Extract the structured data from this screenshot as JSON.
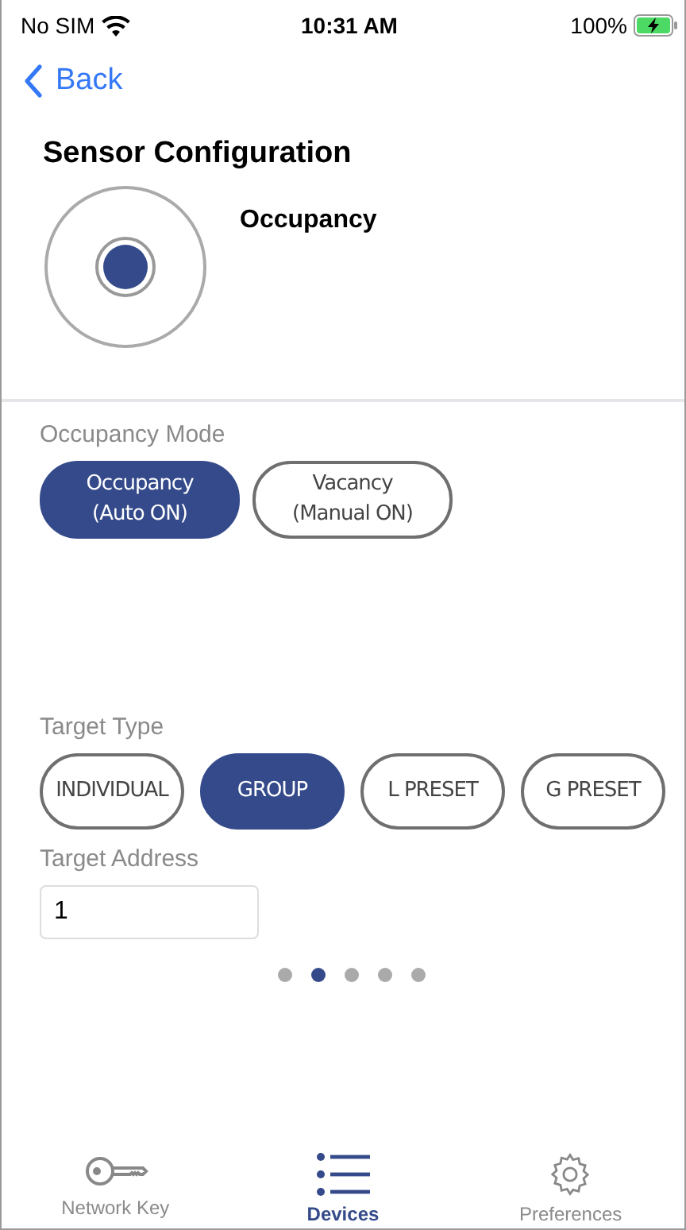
{
  "status_bar": {
    "carrier": "No SIM",
    "time": "10:31 AM",
    "battery": "100%"
  },
  "nav": {
    "back": "Back"
  },
  "title": "Sensor Configuration",
  "sensor": {
    "label": "Occupancy"
  },
  "occupancy_mode": {
    "label": "Occupancy Mode",
    "options": [
      {
        "lines": [
          "Occupancy",
          "(Auto ON)"
        ],
        "selected": true
      },
      {
        "lines": [
          "Vacancy",
          "(Manual ON)"
        ],
        "selected": false
      }
    ]
  },
  "target_type": {
    "label": "Target Type",
    "options": [
      {
        "label": "INDIVIDUAL",
        "selected": false
      },
      {
        "label": "GROUP",
        "selected": true
      },
      {
        "label": "L PRESET",
        "selected": false
      },
      {
        "label": "G PRESET",
        "selected": false
      }
    ]
  },
  "target_address": {
    "label": "Target Address",
    "value": "1"
  },
  "pager": [
    {
      "selected": false
    },
    {
      "selected": true
    },
    {
      "selected": false
    },
    {
      "selected": false
    },
    {
      "selected": false
    }
  ],
  "tab_bar": [
    {
      "kind": "key",
      "label": "Network Key",
      "selected": false
    },
    {
      "kind": "list",
      "label": "Devices",
      "selected": true
    },
    {
      "kind": "gear",
      "label": "Preferences",
      "selected": false
    }
  ]
}
